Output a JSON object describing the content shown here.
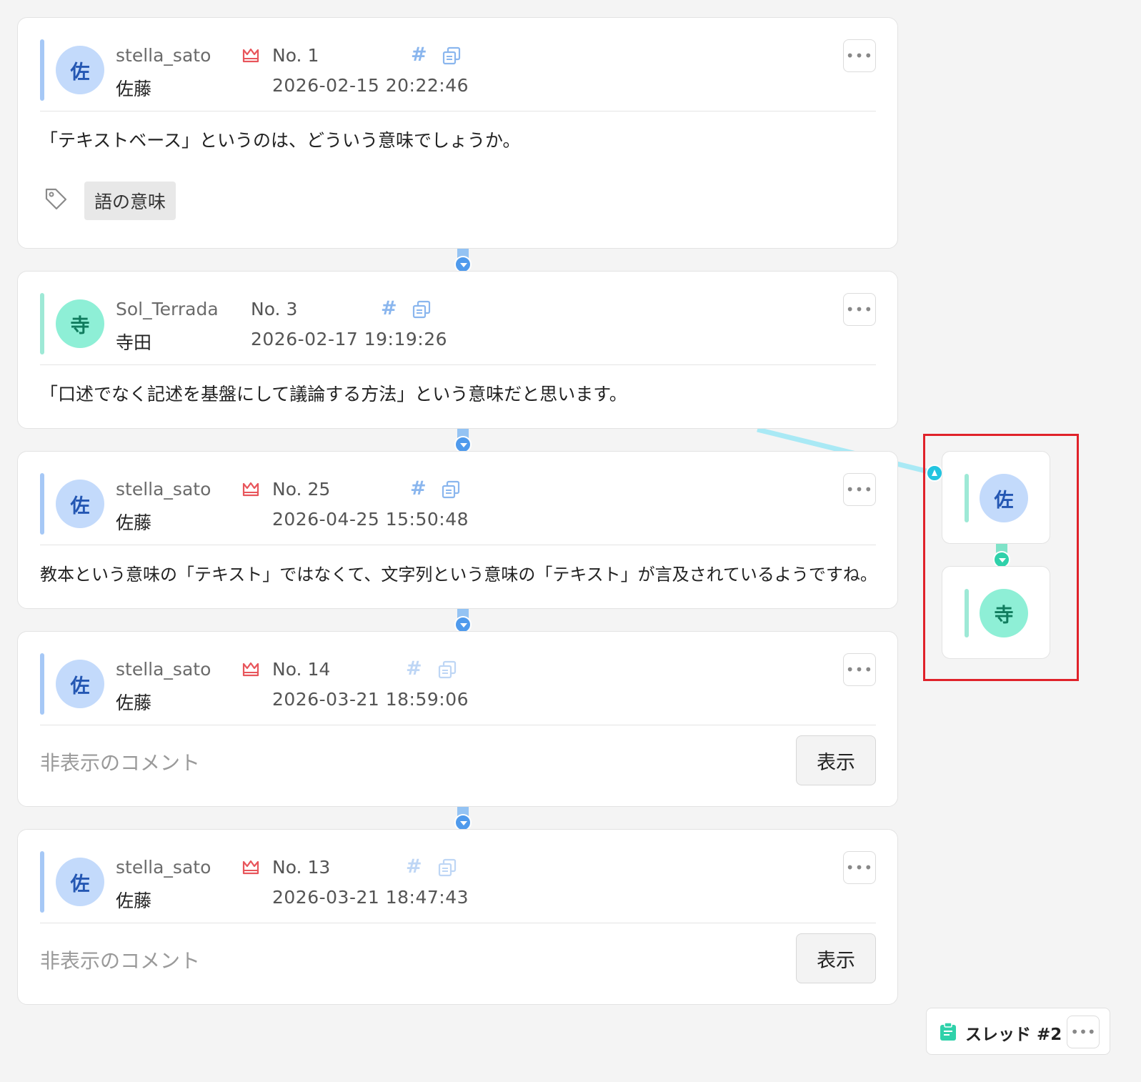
{
  "colors": {
    "sato_avatar_bg": "#c3dafb",
    "sato_avatar_text": "#2457b3",
    "sato_accent": "#a6c8f6",
    "terada_avatar_bg": "#8eefd6",
    "terada_avatar_text": "#107c5e",
    "terada_accent": "#9ee9d6",
    "connector": "#94c3f3",
    "connector_dot": "#4f9aec",
    "side_link": "#a9e9f5",
    "highlight": "#e0222a",
    "crown": "#e8555b"
  },
  "posts": [
    {
      "avatar": "佐",
      "username": "stella_sato",
      "display_name": "佐藤",
      "has_crown": true,
      "number": "No. 1",
      "datetime": "2026-02-15 20:22:46",
      "body": "「テキストベース」というのは、どういう意味でしょうか。",
      "tags": [
        "語の意味"
      ]
    },
    {
      "avatar": "寺",
      "username": "Sol_Terrada",
      "display_name": "寺田",
      "has_crown": false,
      "number": "No. 3",
      "datetime": "2026-02-17 19:19:26",
      "body": "「口述でなく記述を基盤にして議論する方法」という意味だと思います。"
    },
    {
      "avatar": "佐",
      "username": "stella_sato",
      "display_name": "佐藤",
      "has_crown": true,
      "number": "No. 25",
      "datetime": "2026-04-25 15:50:48",
      "body": "教本という意味の「テキスト」ではなくて、文字列という意味の「テキスト」が言及されているようですね。"
    },
    {
      "avatar": "佐",
      "username": "stella_sato",
      "display_name": "佐藤",
      "has_crown": true,
      "number": "No. 14",
      "datetime": "2026-03-21 18:59:06",
      "hidden_text": "非表示のコメント",
      "show_label": "表示"
    },
    {
      "avatar": "佐",
      "username": "stella_sato",
      "display_name": "佐藤",
      "has_crown": true,
      "number": "No. 13",
      "datetime": "2026-03-21 18:47:43",
      "hidden_text": "非表示のコメント",
      "show_label": "表示"
    }
  ],
  "side_thread": {
    "avatars": [
      "佐",
      "寺"
    ]
  },
  "thread_bar": {
    "label": "スレッド #2",
    "icon": "document-icon"
  },
  "icons": {
    "menu": "ellipsis-icon",
    "hash": "hash-icon",
    "copy": "copy-icon",
    "crown": "crown-icon",
    "tag": "tag-icon"
  }
}
